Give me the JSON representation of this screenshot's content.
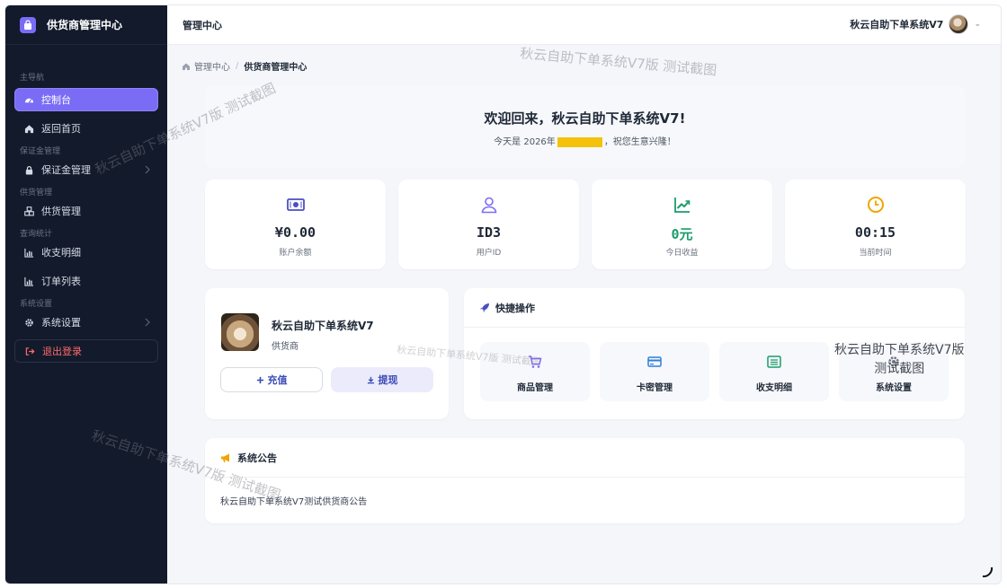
{
  "brand": {
    "title": "供货商管理中心"
  },
  "sidebar": {
    "items": [
      {
        "type": "section",
        "label": "主导航"
      },
      {
        "type": "item",
        "label": "控制台",
        "icon": "dashboard-icon",
        "active": true
      },
      {
        "type": "item",
        "label": "返回首页",
        "icon": "home-icon"
      },
      {
        "type": "section",
        "label": "保证金管理"
      },
      {
        "type": "item",
        "label": "保证金管理",
        "icon": "lock-icon",
        "chevron": true
      },
      {
        "type": "section",
        "label": "供货管理"
      },
      {
        "type": "item",
        "label": "供货管理",
        "icon": "cubes-icon"
      },
      {
        "type": "section",
        "label": "查询统计"
      },
      {
        "type": "item",
        "label": "收支明细",
        "icon": "bar-chart-icon"
      },
      {
        "type": "item",
        "label": "订单列表",
        "icon": "bar-chart-icon"
      },
      {
        "type": "section",
        "label": "系统设置"
      },
      {
        "type": "item",
        "label": "系统设置",
        "icon": "gear-icon",
        "chevron": true
      },
      {
        "type": "item",
        "label": "退出登录",
        "icon": "logout-icon",
        "logout": true
      }
    ]
  },
  "header": {
    "title": "管理中心",
    "username": "秋云自助下单系统V7"
  },
  "breadcrumb": {
    "root": "管理中心",
    "current": "供货商管理中心"
  },
  "welcome": {
    "title": "欢迎回来，秋云自助下单系统V7!",
    "date_prefix": "今天是 2026年",
    "date_suffix": "，祝您生意兴隆！"
  },
  "stats": [
    {
      "value": "¥0.00",
      "label": "账户余额",
      "icon": "money-icon",
      "color": "#4b4fc4"
    },
    {
      "value": "ID3",
      "label": "用户ID",
      "icon": "user-icon",
      "color": "#7b6cf6"
    },
    {
      "value": "0元",
      "label": "今日收益",
      "icon": "trend-icon",
      "color": "#1a9c6b"
    },
    {
      "value": "00:15",
      "label": "当前时间",
      "icon": "clock-icon",
      "color": "#f0a500"
    }
  ],
  "profile": {
    "name": "秋云自助下单系统V7",
    "role": "供货商",
    "recharge_label": "充值",
    "withdraw_label": "提现"
  },
  "quick": {
    "title": "快捷操作",
    "items": [
      {
        "label": "商品管理",
        "icon": "cart-icon",
        "color": "#7b6cf6"
      },
      {
        "label": "卡密管理",
        "icon": "card-icon",
        "color": "#2f7fd8"
      },
      {
        "label": "收支明细",
        "icon": "list-icon",
        "color": "#1a9c6b"
      },
      {
        "label": "系统设置",
        "icon": "gear-icon",
        "color": "#6b7280"
      }
    ]
  },
  "notice": {
    "title": "系统公告",
    "text": "秋云自助下单系统V7测试供货商公告"
  },
  "watermark": {
    "line": "秋云自助下单系统V7版 测试截图",
    "box_line1": "秋云自助下单系统V7版",
    "box_line2": "测试截图"
  },
  "colors": {
    "accent": "#7b6cf6",
    "sidebar_bg": "#131a2b",
    "logout": "#ff6b6b"
  }
}
